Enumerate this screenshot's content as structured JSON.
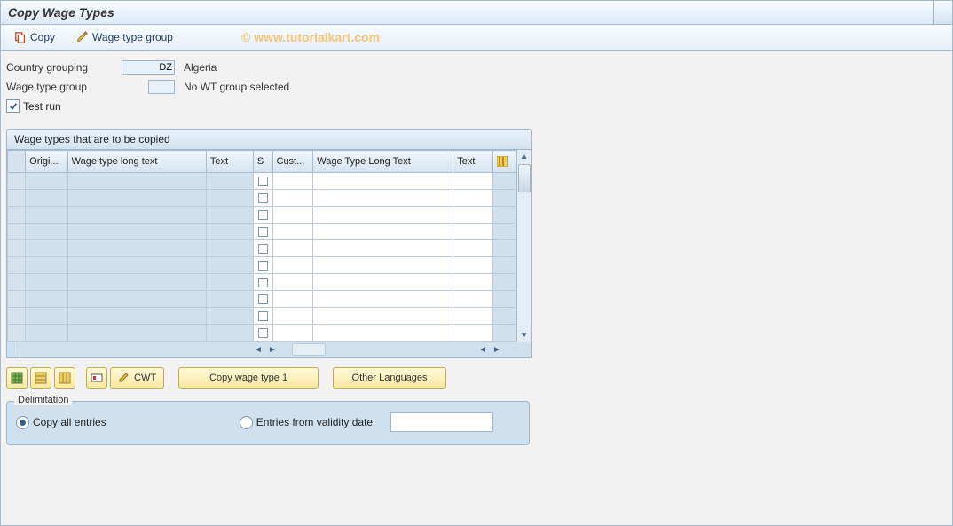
{
  "title": "Copy Wage Types",
  "toolbar": {
    "copy_label": "Copy",
    "wage_type_group_label": "Wage type group"
  },
  "watermark": "© www.tutorialkart.com",
  "form": {
    "country_grouping_label": "Country grouping",
    "country_grouping_value": "DZ",
    "country_grouping_text": "Algeria",
    "wage_type_group_label": "Wage type group",
    "wage_type_group_value": "",
    "wage_type_group_text": "No WT group selected",
    "test_run_label": "Test run",
    "test_run_checked": true
  },
  "table": {
    "title": "Wage types that are to be copied",
    "columns": {
      "origi": "Origi...",
      "wtlt": "Wage type long text",
      "text": "Text",
      "s": "S",
      "cust": "Cust...",
      "wtlt2": "Wage Type Long Text",
      "text2": "Text"
    },
    "row_count": 10
  },
  "buttons": {
    "cwt": "CWT",
    "copy_wt1": "Copy wage type 1",
    "other_lang": "Other Languages"
  },
  "delimitation": {
    "legend": "Delimitation",
    "copy_all": "Copy all entries",
    "from_date": "Entries from validity date",
    "selected": "copy_all",
    "date_value": ""
  }
}
